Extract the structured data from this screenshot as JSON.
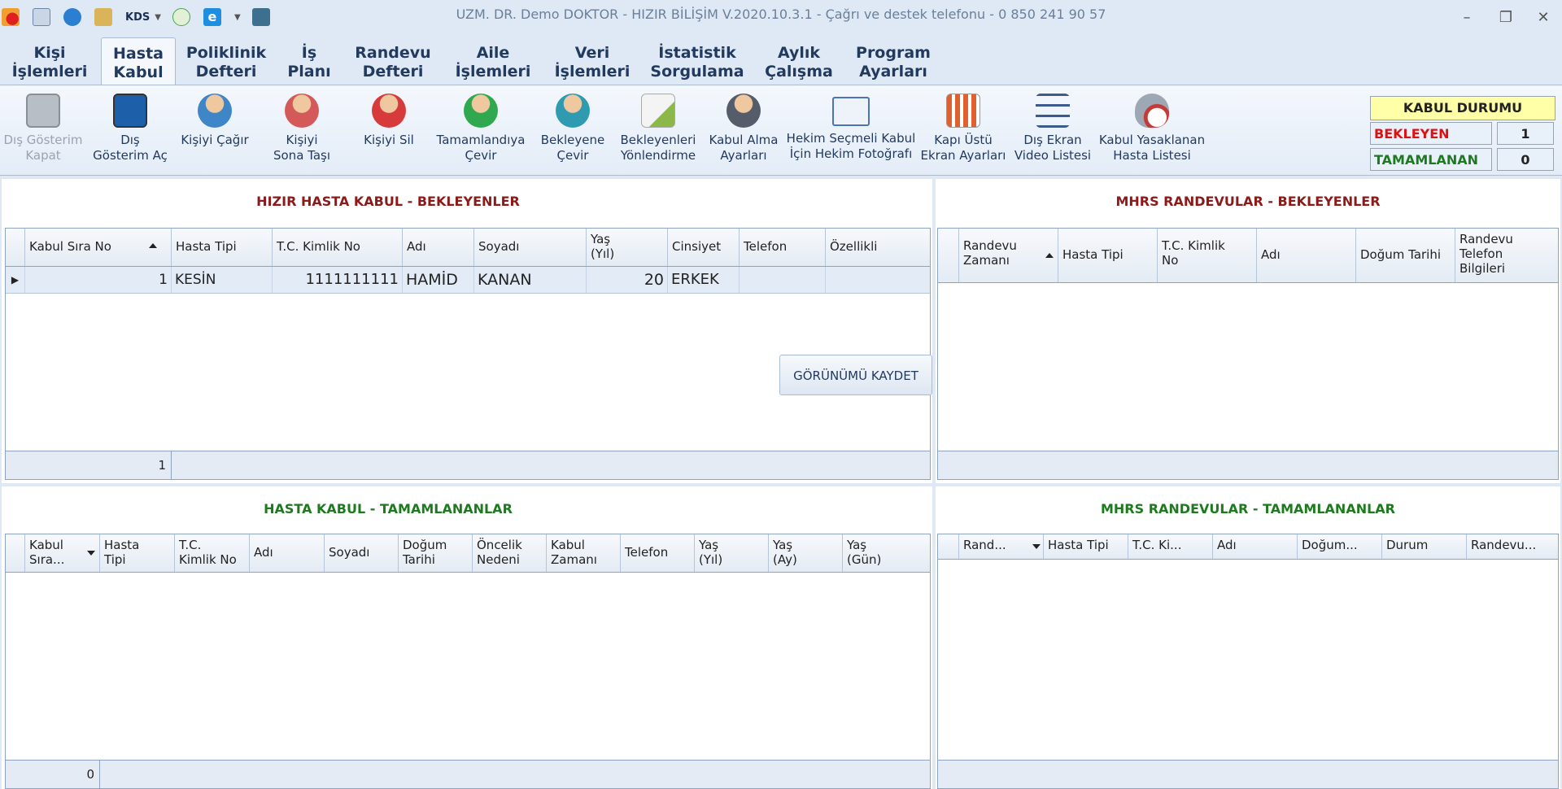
{
  "app": {
    "title": "UZM. DR. Demo DOKTOR - HIZIR BİLİŞİM V.2020.10.3.1 - Çağrı ve destek telefonu - 0 850 241 90 57",
    "quick_access": {
      "kds_label": "KDS"
    }
  },
  "menu": {
    "tabs": [
      {
        "line1": "Kişi",
        "line2": "İşlemleri"
      },
      {
        "line1": "Hasta",
        "line2": "Kabul"
      },
      {
        "line1": "Poliklinik",
        "line2": "Defteri"
      },
      {
        "line1": "İş",
        "line2": "Planı"
      },
      {
        "line1": "Randevu",
        "line2": "Defteri"
      },
      {
        "line1": "Aile",
        "line2": "İşlemleri"
      },
      {
        "line1": "Veri",
        "line2": "İşlemleri"
      },
      {
        "line1": "İstatistik",
        "line2": "Sorgulama"
      },
      {
        "line1": "Aylık",
        "line2": "Çalışma"
      },
      {
        "line1": "Program",
        "line2": "Ayarları"
      }
    ],
    "active_index": 1
  },
  "ribbon": {
    "buttons": [
      {
        "line1": "Dış Gösterim",
        "line2": "Kapat",
        "icon": "monitor-lock-icon",
        "color": "#8a8f96"
      },
      {
        "line1": "Dış",
        "line2": "Gösterim Aç",
        "icon": "monitor-unlock-icon",
        "color": "#3a6fb0"
      },
      {
        "line1": "Kişiyi Çağır",
        "line2": "",
        "icon": "user-call-icon",
        "color": "#3f86c8"
      },
      {
        "line1": "Kişiyi",
        "line2": "Sona Taşı",
        "icon": "user-move-last-icon",
        "color": "#d45a5a"
      },
      {
        "line1": "Kişiyi Sil",
        "line2": "",
        "icon": "user-delete-icon",
        "color": "#d63a3a"
      },
      {
        "line1": "Tamamlandıya",
        "line2": "Çevir",
        "icon": "user-complete-icon",
        "color": "#2fa84f"
      },
      {
        "line1": "Bekleyene",
        "line2": "Çevir",
        "icon": "user-waiting-icon",
        "color": "#2f9bb0"
      },
      {
        "line1": "Bekleyenleri",
        "line2": "Yönlendirme",
        "icon": "envelope-forward-icon",
        "color": "#8cb84a"
      },
      {
        "line1": "Kabul Alma",
        "line2": "Ayarları",
        "icon": "user-settings-icon",
        "color": "#555d6a"
      },
      {
        "line1": "Hekim Seçmeli Kabul",
        "line2": "İçin Hekim Fotoğrafı",
        "icon": "id-card-icon",
        "color": "#4a73b8"
      },
      {
        "line1": "Kapı Üstü",
        "line2": "Ekran Ayarları",
        "icon": "bar-chart-icon",
        "color": "#e06030"
      },
      {
        "line1": "Dış Ekran",
        "line2": "Video Listesi",
        "icon": "list-icon",
        "color": "#3a5b8c"
      },
      {
        "line1": "Kabul Yasaklanan",
        "line2": "Hasta Listesi",
        "icon": "funnel-forbidden-icon",
        "color": "#c23a3a"
      }
    ]
  },
  "kabul_durumu": {
    "title": "KABUL DURUMU",
    "bekleyen_label": "BEKLEYEN",
    "bekleyen_value": "1",
    "tamamlanan_label": "TAMAMLANAN",
    "tamamlanan_value": "0"
  },
  "hasta_kabul_bekleyenler": {
    "title": "HIZIR HASTA KABUL - BEKLEYENLER",
    "save_view_label": "GÖRÜNÜMÜ KAYDET",
    "columns": [
      {
        "line1": "Kabul Sıra No",
        "line2": ""
      },
      {
        "line1": "Hasta Tipi",
        "line2": ""
      },
      {
        "line1": "T.C. Kimlik No",
        "line2": ""
      },
      {
        "line1": "Adı",
        "line2": ""
      },
      {
        "line1": "Soyadı",
        "line2": ""
      },
      {
        "line1": "Yaş",
        "line2": "(Yıl)"
      },
      {
        "line1": "Cinsiyet",
        "line2": ""
      },
      {
        "line1": "Telefon",
        "line2": ""
      },
      {
        "line1": "Özellikli",
        "line2": ""
      }
    ],
    "rows": [
      {
        "sira_no": "1",
        "hasta_tipi": "KESİN",
        "tc": "1111111111",
        "adi": "HAMİD",
        "soyadi": "KANAN",
        "yas": "20",
        "cinsiyet": "ERKEK",
        "telefon": "",
        "ozellikli": ""
      }
    ],
    "footer_count": "1"
  },
  "mhrs_bekleyenler": {
    "title": "MHRS RANDEVULAR - BEKLEYENLER",
    "columns": [
      {
        "line1": "Randevu",
        "line2": "Zamanı",
        "line3": ""
      },
      {
        "line1": "Hasta Tipi",
        "line2": "",
        "line3": ""
      },
      {
        "line1": "T.C. Kimlik",
        "line2": "No",
        "line3": ""
      },
      {
        "line1": "Adı",
        "line2": "",
        "line3": ""
      },
      {
        "line1": "Doğum Tarihi",
        "line2": "",
        "line3": ""
      },
      {
        "line1": "Randevu",
        "line2": "Telefon",
        "line3": "Bilgileri"
      }
    ]
  },
  "hasta_kabul_tamamlananlar": {
    "title": "HASTA KABUL - TAMAMLANANLAR",
    "columns": [
      {
        "line1": "Kabul",
        "line2": "Sıra..."
      },
      {
        "line1": "Hasta",
        "line2": "Tipi"
      },
      {
        "line1": "T.C.",
        "line2": "Kimlik No"
      },
      {
        "line1": "Adı",
        "line2": ""
      },
      {
        "line1": "Soyadı",
        "line2": ""
      },
      {
        "line1": "Doğum",
        "line2": "Tarihi"
      },
      {
        "line1": "Öncelik",
        "line2": "Nedeni"
      },
      {
        "line1": "Kabul",
        "line2": "Zamanı"
      },
      {
        "line1": "Telefon",
        "line2": ""
      },
      {
        "line1": "Yaş",
        "line2": "(Yıl)"
      },
      {
        "line1": "Yaş",
        "line2": "(Ay)"
      },
      {
        "line1": "Yaş",
        "line2": "(Gün)"
      }
    ],
    "footer_count": "0"
  },
  "mhrs_tamamlananlar": {
    "title": "MHRS RANDEVULAR - TAMAMLANANLAR",
    "columns": [
      "Rand...",
      "Hasta Tipi",
      "T.C. Ki...",
      "Adı",
      "Doğum...",
      "Durum",
      "Randevu..."
    ]
  },
  "colors": {
    "title_red": "#8b1a1a",
    "title_green": "#1e7a1e",
    "bekleyen_red": "#e01010",
    "tamamlanan_green": "#1e7a1e"
  }
}
